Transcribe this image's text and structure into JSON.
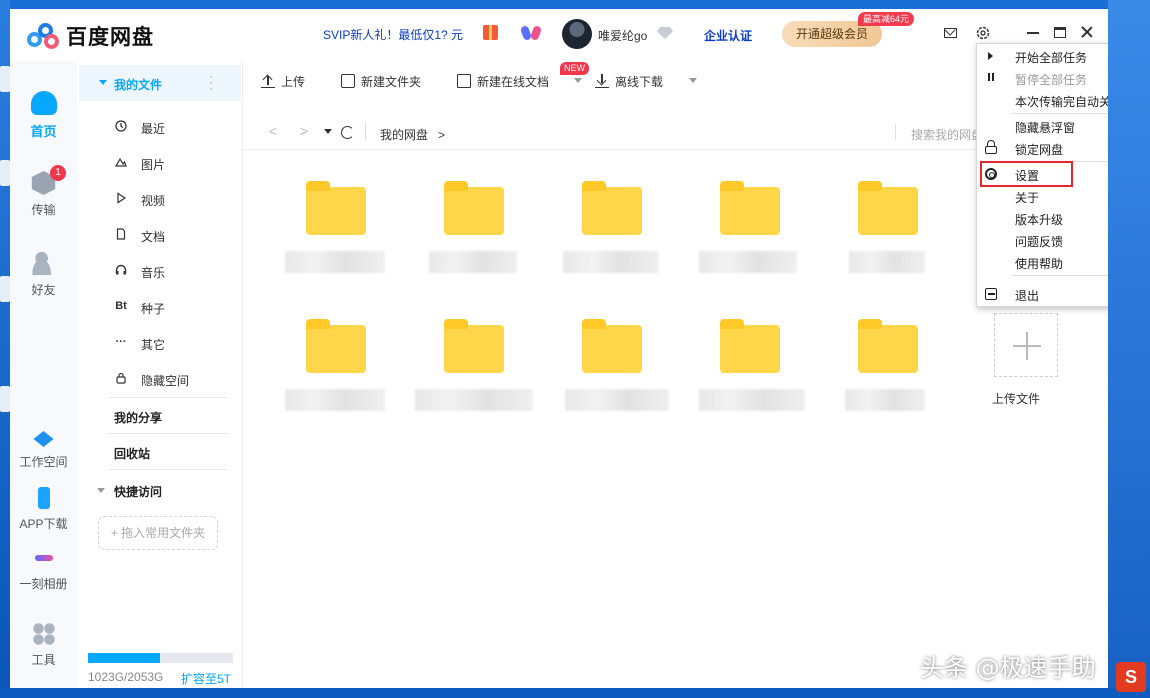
{
  "app": {
    "name": "百度网盘"
  },
  "header": {
    "promo": "SVIP新人礼！最低仅1? 元",
    "username": "唯爱纶go",
    "enterprise": "企业认证",
    "vip_button": "开通超级会员",
    "vip_badge": "最高减64元"
  },
  "left_nav": {
    "items": [
      {
        "label": "首页",
        "icon": "cloud-icon",
        "active": true
      },
      {
        "label": "传输",
        "icon": "transfer-icon",
        "badge": "1"
      },
      {
        "label": "好友",
        "icon": "friends-icon"
      },
      {
        "label": "工作空间",
        "icon": "workspace-icon"
      },
      {
        "label": "APP下载",
        "icon": "phone-icon"
      },
      {
        "label": "一刻相册",
        "icon": "album-icon"
      },
      {
        "label": "工具",
        "icon": "tools-icon"
      }
    ]
  },
  "sidebar": {
    "my_files": "我的文件",
    "items": [
      {
        "label": "最近",
        "icon": "clock-icon"
      },
      {
        "label": "图片",
        "icon": "image-icon"
      },
      {
        "label": "视频",
        "icon": "play-icon"
      },
      {
        "label": "文档",
        "icon": "document-icon"
      },
      {
        "label": "音乐",
        "icon": "headphones-icon"
      },
      {
        "label": "种子",
        "icon": "bt-icon",
        "glyph": "Bt"
      },
      {
        "label": "其它",
        "icon": "more-icon",
        "glyph": "···"
      },
      {
        "label": "隐藏空间",
        "icon": "lock-icon"
      }
    ],
    "my_share": "我的分享",
    "recycle_bin": "回收站",
    "quick_access": "快捷访问",
    "drop_hint": "+ 拖入常用文件夹",
    "storage_text": "1023G/2053G",
    "storage_fraction": 0.498,
    "expand_link": "扩容至5T"
  },
  "toolbar": {
    "upload": "上传",
    "new_folder": "新建文件夹",
    "new_online_doc": "新建在线文档",
    "new_badge": "NEW",
    "offline_download": "离线下载"
  },
  "pathbar": {
    "crumb": "我的网盘",
    "crumb_sep": ">",
    "search_placeholder": "搜索我的网盘文件"
  },
  "files": {
    "folder_count": 10,
    "upload_tile_label": "上传文件"
  },
  "context_menu": {
    "items": [
      {
        "label": "开始全部任务",
        "icon": "play-icon"
      },
      {
        "label": "暂停全部任务",
        "icon": "pause-icon",
        "disabled": true
      },
      {
        "label": "本次传输完自动关机"
      },
      {
        "label": "隐藏悬浮窗"
      },
      {
        "label": "锁定网盘",
        "icon": "lock-icon"
      },
      {
        "label": "设置",
        "icon": "gear-icon",
        "highlighted": true
      },
      {
        "label": "关于"
      },
      {
        "label": "版本升级"
      },
      {
        "label": "问题反馈"
      },
      {
        "label": "使用帮助"
      },
      {
        "label": "退出",
        "icon": "exit-icon"
      }
    ]
  },
  "watermark": {
    "text": "头条 @极速手助"
  },
  "colors": {
    "accent": "#06a7ff",
    "promo": "#0a3cc8",
    "highlight_box": "#e2262f",
    "folder": "#ffd54a"
  }
}
